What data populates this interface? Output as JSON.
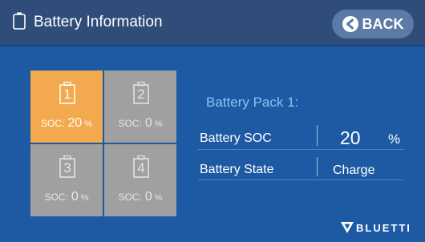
{
  "header": {
    "title": "Battery Information",
    "back_label": "BACK"
  },
  "packs": [
    {
      "number": "1",
      "soc_label": "SOC:",
      "soc_value": "20",
      "unit": "%",
      "active": true
    },
    {
      "number": "2",
      "soc_label": "SOC:",
      "soc_value": "0",
      "unit": "%",
      "active": false
    },
    {
      "number": "3",
      "soc_label": "SOC:",
      "soc_value": "0",
      "unit": "%",
      "active": false
    },
    {
      "number": "4",
      "soc_label": "SOC:",
      "soc_value": "0",
      "unit": "%",
      "active": false
    }
  ],
  "details": {
    "title": "Battery Pack 1:",
    "soc_label": "Battery SOC",
    "soc_value": "20",
    "soc_unit": "%",
    "state_label": "Battery State",
    "state_value": "Charge"
  },
  "brand": "BLUETTI",
  "colors": {
    "background": "#1e5aa3",
    "header": "#2f4d78",
    "active_pack": "#f3a94d",
    "inactive_pack": "#a0a0a0",
    "pack_title": "#7fc8f0"
  }
}
